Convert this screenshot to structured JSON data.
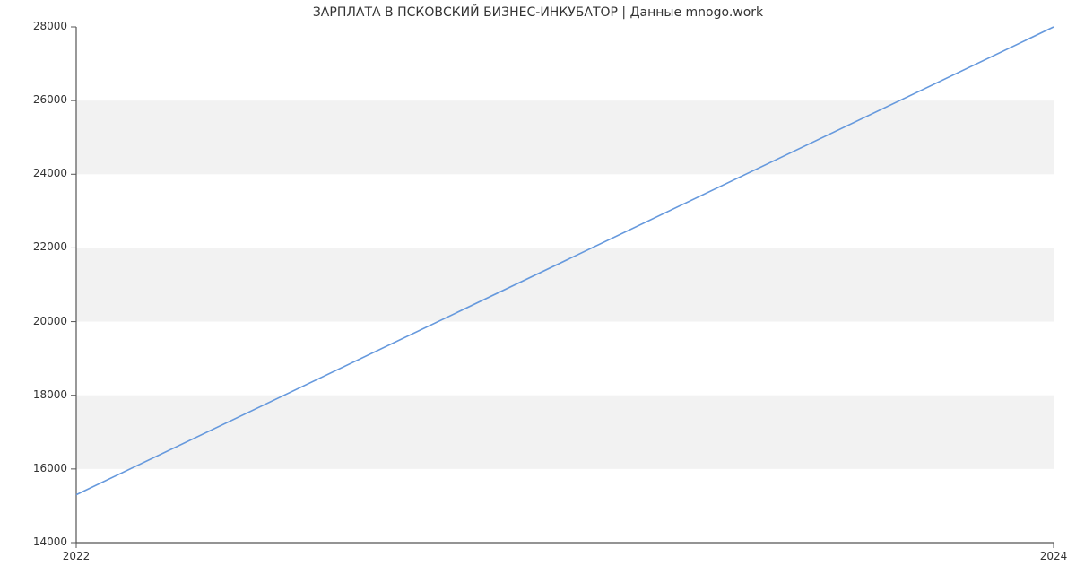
{
  "chart_data": {
    "type": "line",
    "title": "ЗАРПЛАТА В ПСКОВСКИЙ БИЗНЕС-ИНКУБАТОР | Данные mnogo.work",
    "xlabel": "",
    "ylabel": "",
    "x": [
      2022,
      2024
    ],
    "series": [
      {
        "name": "",
        "values": [
          15300,
          28000
        ]
      }
    ],
    "y_ticks": [
      14000,
      16000,
      18000,
      20000,
      22000,
      24000,
      26000,
      28000
    ],
    "x_ticks": [
      2022,
      2024
    ],
    "xlim": [
      2022,
      2024
    ],
    "ylim": [
      14000,
      28000
    ],
    "colors": {
      "line": "#6699dd",
      "band": "#f2f2f2",
      "axis": "#555555",
      "tick": "#555555",
      "grid": "#ffffff"
    }
  }
}
